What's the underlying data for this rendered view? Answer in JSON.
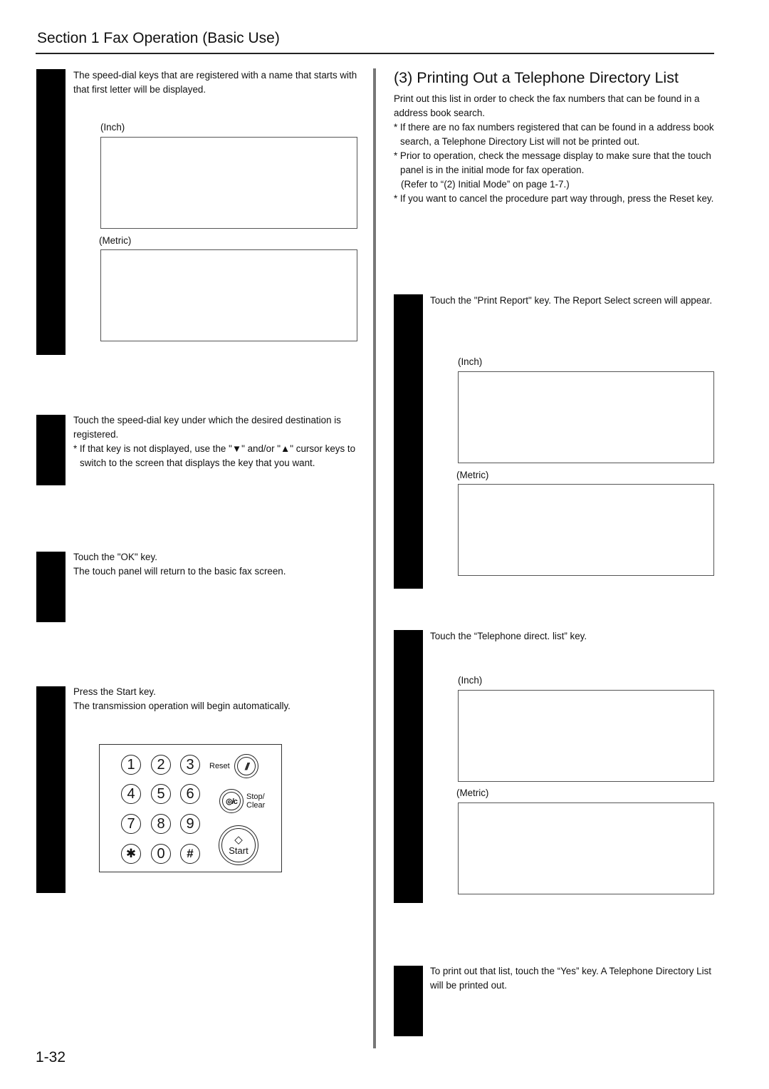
{
  "header": {
    "section_title": "Section 1  Fax Operation (Basic Use)"
  },
  "left_column": {
    "step_a": {
      "text": "The speed-dial keys that are registered with a name that starts with that first letter will be displayed.",
      "screens": [
        {
          "label": "(Inch)"
        },
        {
          "label": "(Metric)"
        }
      ]
    },
    "step_b": {
      "text": "Touch the speed-dial key under which the desired destination is registered.",
      "note": "* If that key is not displayed, use the \"▼\" and/or \"▲\" cursor keys to switch to the screen that displays the key that you want."
    },
    "step_c": {
      "line1": "Touch the \"OK\" key.",
      "line2": "The touch panel will return to the basic fax screen."
    },
    "step_d": {
      "line1": "Press the Start key.",
      "line2": "The transmission operation will begin automatically."
    },
    "keypad": {
      "digits": [
        "1",
        "2",
        "3",
        "4",
        "5",
        "6",
        "7",
        "8",
        "9",
        "✱",
        "0",
        "#"
      ],
      "reset_label": "Reset",
      "reset_icon": "//",
      "stop_label_1": "Stop/",
      "stop_label_2": "Clear",
      "stop_icon": "◎/c",
      "start_label": "Start",
      "start_icon": "◇"
    }
  },
  "right_column": {
    "heading": "(3) Printing Out a Telephone Directory List",
    "intro": "Print out this list in order to check the fax numbers that can be found in a address book search.",
    "notes": [
      "* If there are no fax numbers registered that can be found in a address book search, a Telephone Directory List will not be printed out.",
      "* Prior to operation, check the message display to make sure that the touch panel is in the initial mode for fax operation.",
      "(Refer to “(2) Initial Mode” on page 1-7.)",
      "* If you want to cancel the procedure part way through, press the Reset key."
    ],
    "step_1": {
      "text": "Touch the \"Print Report\" key. The Report Select screen will appear.",
      "screens": [
        {
          "label": "(Inch)"
        },
        {
          "label": "(Metric)"
        }
      ]
    },
    "step_2": {
      "text": "Touch the “Telephone direct. list” key.",
      "screens": [
        {
          "label": "(Inch)"
        },
        {
          "label": "(Metric)"
        }
      ]
    },
    "step_3": {
      "text": "To print out that list, touch the “Yes” key. A Telephone Directory List will be printed out."
    }
  },
  "footer": {
    "page_number": "1-32"
  }
}
